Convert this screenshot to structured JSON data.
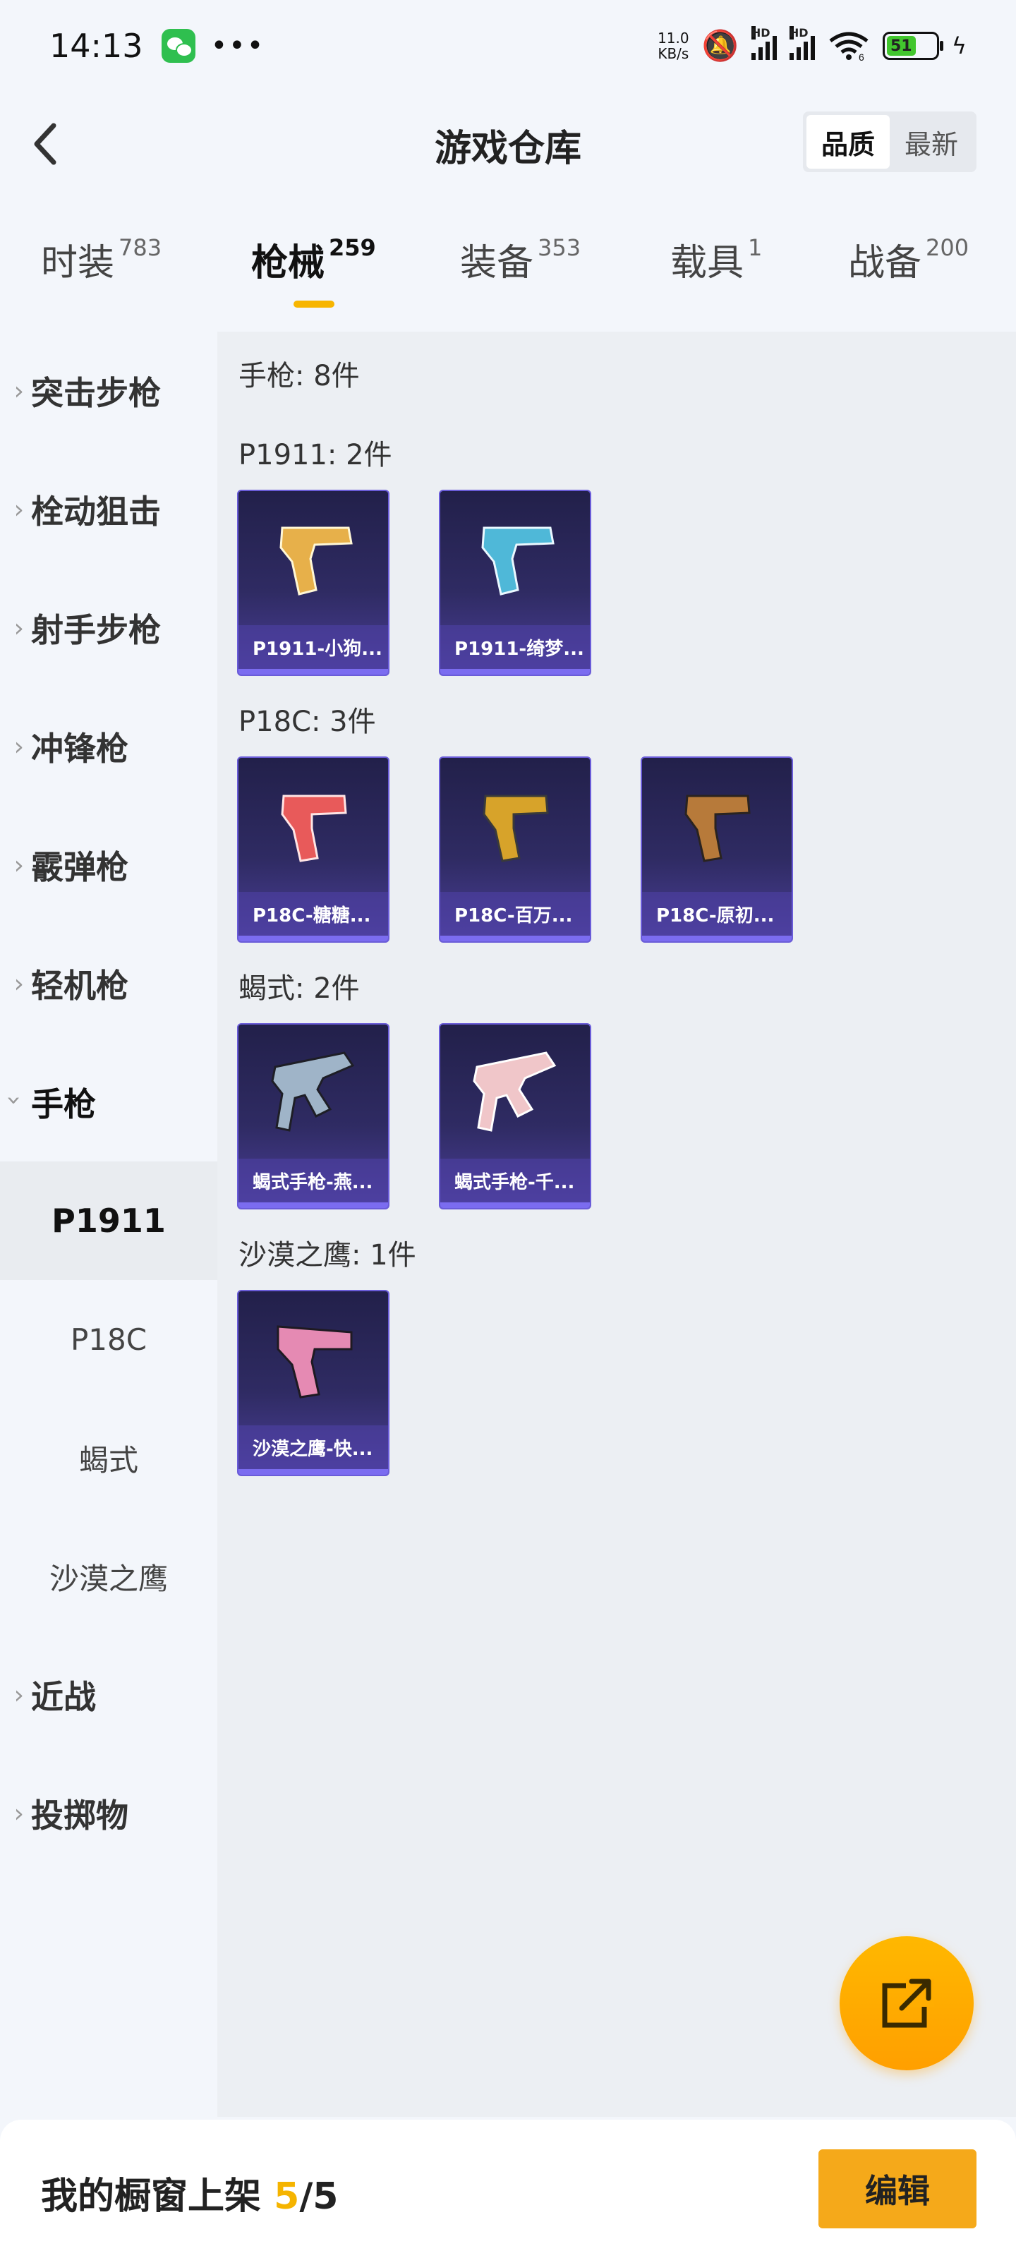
{
  "status_bar": {
    "time": "14:13",
    "net_speed_value": "11.0",
    "net_speed_unit": "KB/s",
    "hd_label": "HD",
    "wifi_badge": "6",
    "battery": "51"
  },
  "header": {
    "title": "游戏仓库",
    "sort_options": [
      "品质",
      "最新"
    ],
    "active_sort": "品质"
  },
  "tabs": [
    {
      "label": "时装",
      "count": "783"
    },
    {
      "label": "枪械",
      "count": "259"
    },
    {
      "label": "装备",
      "count": "353"
    },
    {
      "label": "载具",
      "count": "1"
    },
    {
      "label": "战备",
      "count": "200"
    }
  ],
  "active_tab": "枪械",
  "sidebar": {
    "items": [
      {
        "label": "突击步枪"
      },
      {
        "label": "栓动狙击"
      },
      {
        "label": "射手步枪"
      },
      {
        "label": "冲锋枪"
      },
      {
        "label": "霰弹枪"
      },
      {
        "label": "轻机枪"
      },
      {
        "label": "手枪"
      }
    ],
    "sub_items": [
      {
        "label": "P1911"
      },
      {
        "label": "P18C"
      },
      {
        "label": "蝎式"
      },
      {
        "label": "沙漠之鹰"
      }
    ],
    "items_after": [
      {
        "label": "近战"
      },
      {
        "label": "投掷物"
      }
    ],
    "active_sub": "P1911"
  },
  "content": {
    "category_summary": "手枪: 8件",
    "groups": [
      {
        "title": "P1911: 2件",
        "items": [
          {
            "name": "P1911-小狗...",
            "skin_color": "#e7b04a"
          },
          {
            "name": "P1911-绮梦...",
            "skin_color": "#4fb8d8"
          }
        ]
      },
      {
        "title": "P18C: 3件",
        "items": [
          {
            "name": "P18C-糖糖...",
            "skin_color": "#e85a5a"
          },
          {
            "name": "P18C-百万...",
            "skin_color": "#d7a32a"
          },
          {
            "name": "P18C-原初...",
            "skin_color": "#b77a3a"
          }
        ]
      },
      {
        "title": "蝎式: 2件",
        "items": [
          {
            "name": "蝎式手枪-燕...",
            "skin_color": "#9fb4c8"
          },
          {
            "name": "蝎式手枪-千...",
            "skin_color": "#f0c6c9"
          }
        ]
      },
      {
        "title": "沙漠之鹰: 1件",
        "items": [
          {
            "name": "沙漠之鹰-快...",
            "skin_color": "#e58ab3"
          }
        ]
      }
    ]
  },
  "bottom_bar": {
    "shelf_label": "我的橱窗上架",
    "shelf_count": "5",
    "shelf_total": "/5",
    "edit_label": "编辑"
  },
  "colors": {
    "accent": "#f5a91a",
    "tab_indicator": "#f7b500",
    "card_border": "#6a5cd8"
  }
}
